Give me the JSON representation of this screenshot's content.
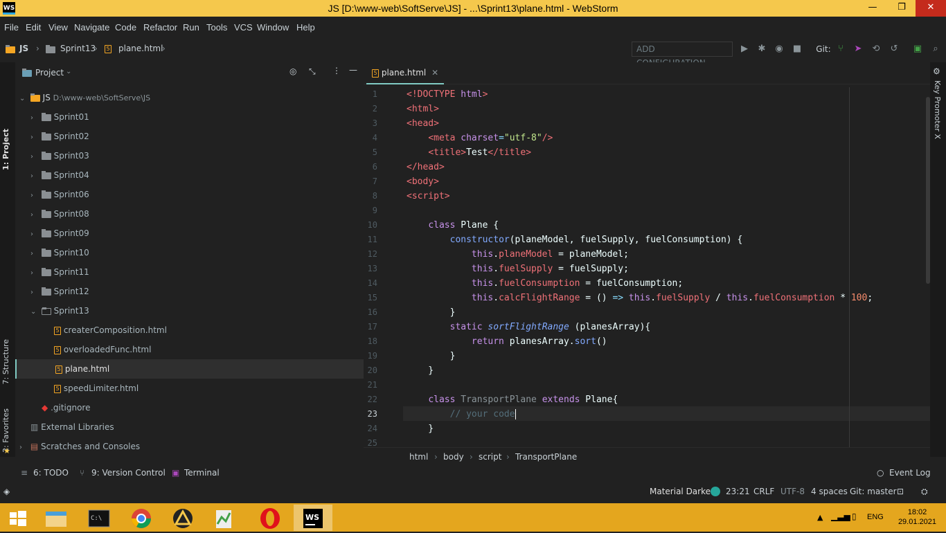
{
  "window": {
    "title": "JS [D:\\www-web\\SoftServe\\JS] - ...\\Sprint13\\plane.html - WebStorm",
    "logo": "WS"
  },
  "menu": [
    "File",
    "Edit",
    "View",
    "Navigate",
    "Code",
    "Refactor",
    "Run",
    "Tools",
    "VCS",
    "Window",
    "Help"
  ],
  "breadcrumb": [
    "JS",
    "Sprint13",
    "plane.html"
  ],
  "toolbar": {
    "add_config": "ADD CONFIGURATION...",
    "git_label": "Git:"
  },
  "left_tabs": {
    "project": "1: Project",
    "structure": "7: Structure",
    "favorites": "2: Favorites"
  },
  "right_tabs": {
    "key_promoter": "Key Promoter X"
  },
  "project": {
    "header": "Project",
    "root_name": "JS",
    "root_path": "D:\\www-web\\SoftServe\\JS",
    "folders": [
      "Sprint01",
      "Sprint02",
      "Sprint03",
      "Sprint04",
      "Sprint06",
      "Sprint08",
      "Sprint09",
      "Sprint10",
      "Sprint11",
      "Sprint12",
      "Sprint13"
    ],
    "files": [
      "createrComposition.html",
      "overloadedFunc.html",
      "plane.html",
      "speedLimiter.html"
    ],
    "gitignore": ".gitignore",
    "external": "External Libraries",
    "scratches": "Scratches and Consoles"
  },
  "editor": {
    "tab": "plane.html",
    "line_numbers": [
      "1",
      "2",
      "3",
      "4",
      "5",
      "6",
      "7",
      "8",
      "9",
      "10",
      "11",
      "12",
      "13",
      "14",
      "15",
      "16",
      "17",
      "18",
      "19",
      "20",
      "21",
      "22",
      "23",
      "24",
      "25"
    ],
    "breadcrumb": [
      "html",
      "body",
      "script",
      "TransportPlane"
    ]
  },
  "bottom_tabs": {
    "todo": "6: TODO",
    "vcs": "9: Version Control",
    "terminal": "Terminal",
    "event_log": "Event Log"
  },
  "status": {
    "theme": "Material Darker",
    "position": "23:21",
    "line_sep": "CRLF",
    "encoding": "UTF-8",
    "indent": "4 spaces",
    "git": "Git: master"
  },
  "taskbar": {
    "lang": "ENG",
    "time": "18:02",
    "date": "29.01.2021"
  }
}
